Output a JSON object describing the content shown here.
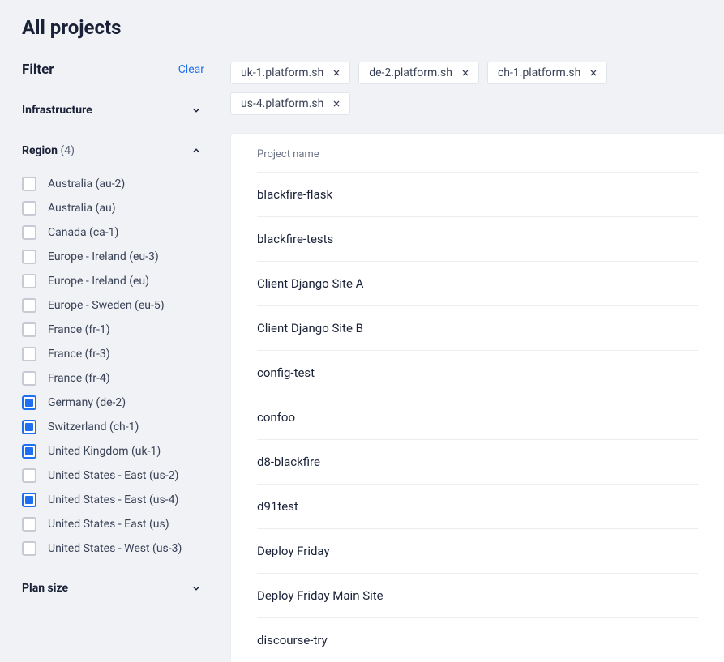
{
  "page": {
    "title": "All projects"
  },
  "filter": {
    "title": "Filter",
    "clear_label": "Clear",
    "sections": {
      "infrastructure": {
        "title": "Infrastructure"
      },
      "region": {
        "title": "Region",
        "count": "(4)"
      },
      "plan_size": {
        "title": "Plan size"
      }
    },
    "region_options": [
      {
        "label": "Australia (au-2)",
        "checked": false
      },
      {
        "label": "Australia (au)",
        "checked": false
      },
      {
        "label": "Canada (ca-1)",
        "checked": false
      },
      {
        "label": "Europe - Ireland (eu-3)",
        "checked": false
      },
      {
        "label": "Europe - Ireland (eu)",
        "checked": false
      },
      {
        "label": "Europe - Sweden (eu-5)",
        "checked": false
      },
      {
        "label": "France (fr-1)",
        "checked": false
      },
      {
        "label": "France (fr-3)",
        "checked": false
      },
      {
        "label": "France (fr-4)",
        "checked": false
      },
      {
        "label": "Germany (de-2)",
        "checked": true
      },
      {
        "label": "Switzerland (ch-1)",
        "checked": true
      },
      {
        "label": "United Kingdom (uk-1)",
        "checked": true
      },
      {
        "label": "United States - East (us-2)",
        "checked": false
      },
      {
        "label": "United States - East (us-4)",
        "checked": true
      },
      {
        "label": "United States - East (us)",
        "checked": false
      },
      {
        "label": "United States - West (us-3)",
        "checked": false
      }
    ]
  },
  "chips": [
    {
      "label": "uk-1.platform.sh"
    },
    {
      "label": "de-2.platform.sh"
    },
    {
      "label": "ch-1.platform.sh"
    },
    {
      "label": "us-4.platform.sh"
    }
  ],
  "table": {
    "column_header": "Project name",
    "rows": [
      {
        "name": "blackfire-flask"
      },
      {
        "name": "blackfire-tests"
      },
      {
        "name": "Client Django Site A"
      },
      {
        "name": "Client Django Site B"
      },
      {
        "name": "config-test"
      },
      {
        "name": "confoo"
      },
      {
        "name": "d8-blackfire"
      },
      {
        "name": "d91test"
      },
      {
        "name": "Deploy Friday"
      },
      {
        "name": "Deploy Friday Main Site"
      },
      {
        "name": "discourse-try"
      }
    ]
  }
}
